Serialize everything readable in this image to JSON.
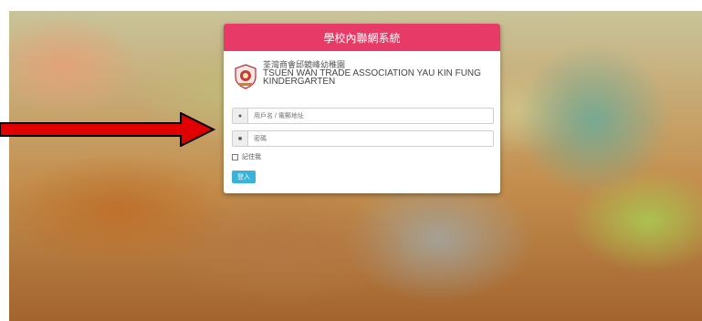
{
  "header": {
    "title": "學校內聯網系統"
  },
  "school": {
    "name_zh": "荃灣商會邱鏡峰幼稚園",
    "name_en_line1": "TSUEN WAN TRADE ASSOCIATION YAU KIN FUNG",
    "name_en_line2": "KINDERGARTEN"
  },
  "form": {
    "username_placeholder": "用戶名 / 電郵地址",
    "password_placeholder": "密碼",
    "remember_label": "記住我",
    "login_label": "登入"
  },
  "icons": {
    "user": "user-icon",
    "lock": "lock-icon",
    "arrow": "arrow-right-icon"
  },
  "colors": {
    "header": "#e83a67",
    "button": "#39b3d7",
    "arrow": "#e10000"
  }
}
